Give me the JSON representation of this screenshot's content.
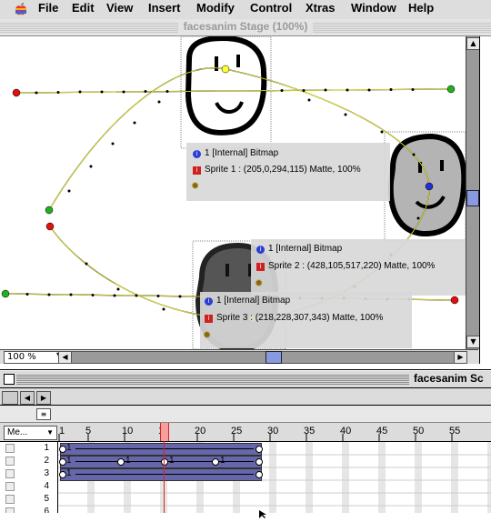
{
  "menubar": {
    "apple": "",
    "items": [
      "File",
      "Edit",
      "View",
      "Insert",
      "Modify",
      "Control",
      "Xtras",
      "Window",
      "Help"
    ]
  },
  "stage": {
    "title": "facesanim Stage (100%)",
    "zoom": "100 %",
    "sprites": [
      {
        "member": "1  [Internal] Bitmap",
        "info": "Sprite 1 : (205,0,294,115) Matte, 100%"
      },
      {
        "member": "1  [Internal] Bitmap",
        "info": "Sprite 2 : (428,105,517,220) Matte, 100%"
      },
      {
        "member": "1  [Internal] Bitmap",
        "info": "Sprite 3 : (218,228,307,343) Matte, 100%"
      }
    ]
  },
  "score": {
    "title": "facesanim Sc",
    "member_dropdown": "Me...",
    "frame_labels": [
      "1",
      "5",
      "10",
      "15",
      "20",
      "25",
      "30",
      "35",
      "40",
      "45",
      "50",
      "55"
    ],
    "channels": [
      "1",
      "2",
      "3",
      "4",
      "5",
      "6"
    ],
    "playhead_frame": 15,
    "sprite_bars": [
      {
        "channel": 1,
        "start_label": "1",
        "keyframes": []
      },
      {
        "channel": 2,
        "start_label": "1",
        "keyframes": [
          "1",
          "1",
          "1"
        ]
      },
      {
        "channel": 3,
        "start_label": "1",
        "keyframes": []
      }
    ]
  },
  "colors": {
    "menubar_bg": "#dddddd",
    "window_bg": "#dcdcdc",
    "path_yellow": "#ffff33",
    "sprite_bar": "#6666aa",
    "playhead": "#e02020",
    "scroll_thumb": "#8899dd"
  }
}
